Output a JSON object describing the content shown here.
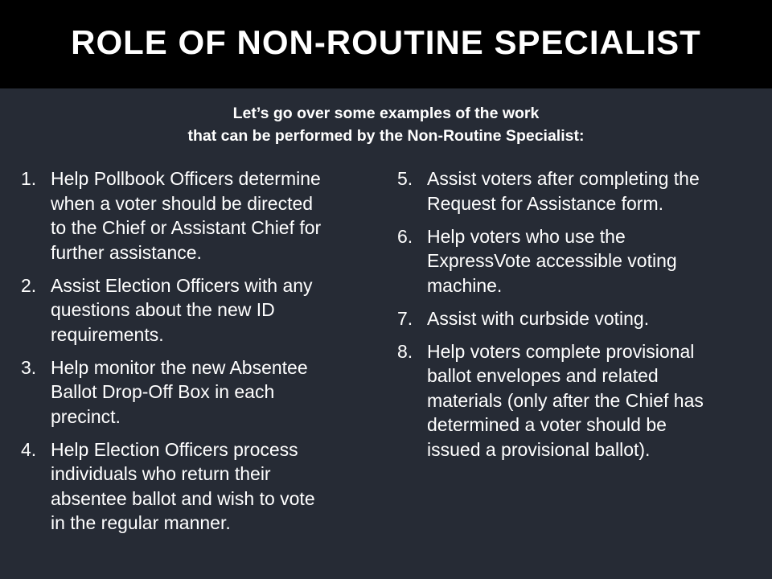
{
  "slide": {
    "title": "ROLE OF NON-ROUTINE SPECIALIST",
    "intro_lines": [
      "Let’s go over some examples of the work",
      "that can be performed by the Non-Routine Specialist:"
    ],
    "left_items": [
      {
        "number": "1.",
        "lines": [
          "Help Pollbook Officers determine",
          "when a voter should be directed",
          "to the Chief or Assistant Chief for",
          "further assistance."
        ]
      },
      {
        "number": "2.",
        "lines": [
          "Assist Election Officers with any",
          "questions about the new ID",
          "requirements."
        ]
      },
      {
        "number": "3.",
        "lines": [
          "Help monitor the new Absentee",
          "Ballot Drop-Off Box in each",
          "precinct."
        ]
      },
      {
        "number": "4.",
        "lines": [
          "Help Election Officers process",
          "individuals who return their",
          "absentee ballot and wish to vote",
          "in the regular manner."
        ]
      }
    ],
    "right_items": [
      {
        "number": "5.",
        "lines": [
          "Assist voters after completing the",
          "Request for Assistance form."
        ]
      },
      {
        "number": "6.",
        "lines": [
          "Help voters who use the",
          "ExpressVote accessible voting",
          "machine."
        ]
      },
      {
        "number": "7.",
        "lines": [
          "Assist with curbside voting."
        ]
      },
      {
        "number": "8.",
        "lines": [
          "Help voters complete provisional",
          "ballot envelopes and related",
          "materials (only after the Chief has",
          "determined a voter should be",
          "issued a provisional ballot)."
        ]
      }
    ]
  }
}
